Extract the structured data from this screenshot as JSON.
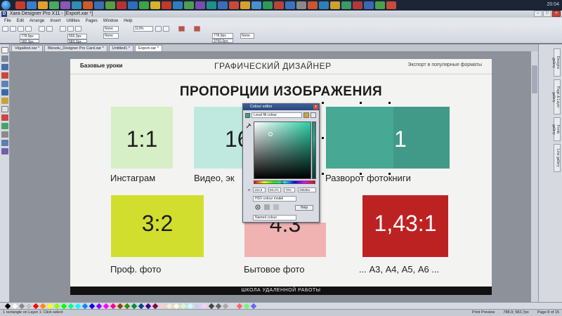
{
  "taskbar": {
    "clock": "20:04"
  },
  "window": {
    "title": "Xara Designer Pro X11 - [Export.xar *]",
    "app_icon": "D"
  },
  "menu": [
    "File",
    "Edit",
    "Arrange",
    "Insert",
    "Utilities",
    "Pages",
    "Window",
    "Help"
  ],
  "toolbar": {
    "x": "778,9px",
    "y": "182,3px",
    "w": "555,3px",
    "h": "583,2px",
    "angle": "0°",
    "zoom": "113%",
    "line_width": "None",
    "fill_none": "None",
    "px_field": "778,9px",
    "px_field2": "3760,0px"
  },
  "tabs": [
    {
      "label": "Vkgallest.xar *",
      "active": false
    },
    {
      "label": "Blesolu_Designer Pro Card.xar *",
      "active": false
    },
    {
      "label": "Untitled1 *",
      "active": false
    },
    {
      "label": "Export.xar *",
      "active": true
    }
  ],
  "slide": {
    "header_left": "Базовые уроки",
    "header_center": "ГРАФИЧЕСКИЙ ДИЗАЙНЕР",
    "header_right": "Экспорт в популярные форматы",
    "title": "ПРОПОРЦИИ ИЗОБРАЖЕНИЯ",
    "footer": "ШКОЛА УДАЛЕННОЙ РАБОТЫ",
    "cards": [
      {
        "ratio": "1:1",
        "caption": "Инстаграм",
        "color": "#d6efc6"
      },
      {
        "ratio": "16",
        "caption": "Видео, эк",
        "color": "#bfe9df"
      },
      {
        "ratio": "1",
        "caption": "Разворот фотокниги",
        "color": "#47a893"
      },
      {
        "ratio": "3:2",
        "caption": "Проф. фото",
        "color": "#d2de2e"
      },
      {
        "ratio": "4:3",
        "caption": "Бытовое фото",
        "color": "#f0b3b2"
      },
      {
        "ratio": "1,43:1",
        "caption": "... А3, А4, А5, А6 ...",
        "color": "#bd2223"
      }
    ]
  },
  "colour_editor": {
    "title": "Colour editor",
    "source": "Local fill colour",
    "close_label": "x",
    "values": [
      "163,9",
      "68,2%",
      "79%",
      "39bd8a"
    ],
    "model": "HSV colour model",
    "help": "Help",
    "named": "Named colour"
  },
  "status": {
    "left": "1 rectangle on Layer 1: Click select",
    "preview": "Print Preview",
    "coords": "788,9; 582,7px",
    "page": "Page 8 of 15"
  },
  "palette_colors": [
    "#000000",
    "#ffffff",
    "#888888",
    "#c0c0c0",
    "#ff0000",
    "#ff8800",
    "#ffff00",
    "#88ff00",
    "#00ff00",
    "#00ff88",
    "#00ffff",
    "#0088ff",
    "#0000ff",
    "#8800ff",
    "#ff00ff",
    "#ff0088",
    "#884400",
    "#448800",
    "#008844",
    "#004488",
    "#440088",
    "#880044",
    "#ffcccc",
    "#ffeecc",
    "#ffffcc",
    "#ccffcc",
    "#ccffff",
    "#ccccff",
    "#ffccff",
    "#444444",
    "#666666",
    "#aaaaaa",
    "#dddddd",
    "#ff6666",
    "#66ff66",
    "#6666ff"
  ]
}
